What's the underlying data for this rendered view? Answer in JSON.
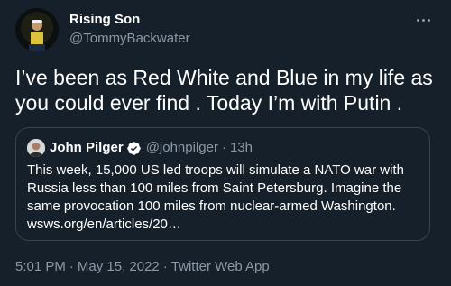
{
  "author": {
    "name": "Rising Son",
    "handle": "@TommyBackwater"
  },
  "tweet": {
    "text": "I’ve been as Red White and Blue in my life as you could ever find . Today I’m with Putin ."
  },
  "quoted": {
    "name": "John Pilger",
    "handle": "@johnpilger",
    "separator": "·",
    "time": "13h",
    "text": "This week, 15,000 US led troops will simulate a NATO war with Russia less than 100 miles from Saint Petersburg. Imagine the same provocation 100 miles from nuclear-armed Washington. wsws.org/en/articles/20…"
  },
  "meta": {
    "time": "5:01 PM",
    "dot1": "·",
    "date": "May 15, 2022",
    "dot2": "·",
    "source": "Twitter Web App"
  },
  "icons": {
    "more": "more-dots-icon",
    "verified": "verified-badge-icon"
  },
  "colors": {
    "background": "#15202b",
    "secondary_text": "#8b98a5",
    "verified_blue": "#1d9bf0",
    "border": "#38444d"
  }
}
